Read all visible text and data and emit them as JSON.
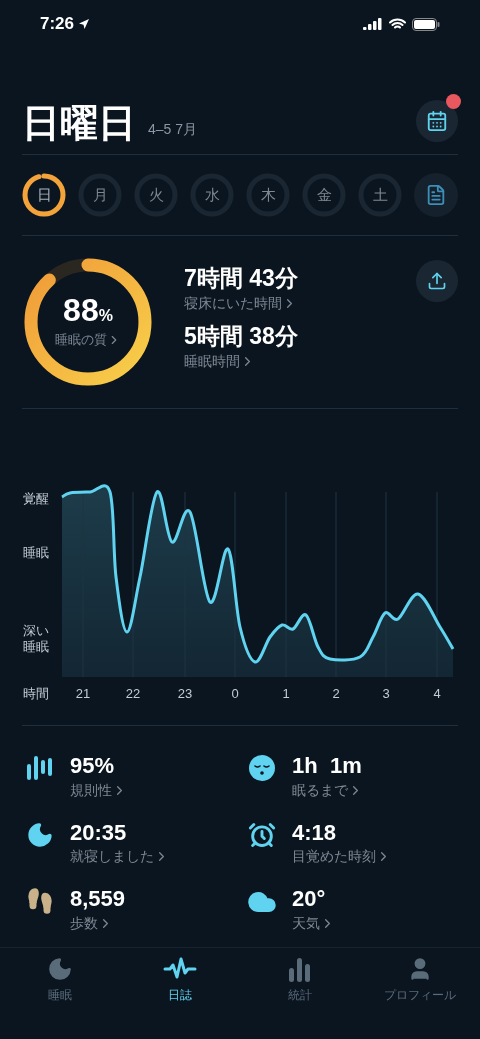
{
  "status_bar": {
    "time": "7:26"
  },
  "header": {
    "title": "日曜日",
    "date_range": "4–5 7月",
    "calendar_badge": true
  },
  "days": [
    {
      "label": "日",
      "selected": true
    },
    {
      "label": "月",
      "selected": false
    },
    {
      "label": "火",
      "selected": false
    },
    {
      "label": "水",
      "selected": false
    },
    {
      "label": "木",
      "selected": false
    },
    {
      "label": "金",
      "selected": false
    },
    {
      "label": "土",
      "selected": false
    }
  ],
  "summary": {
    "quality": {
      "value": "88",
      "unit": "%",
      "label": "睡眠の質",
      "level": 0.88
    },
    "metrics": [
      {
        "value": "7時間 43分",
        "label": "寝床にいた時間"
      },
      {
        "value": "5時間 38分",
        "label": "睡眠時間"
      }
    ]
  },
  "sleep_chart": {
    "y_labels": [
      {
        "lines": [
          "覚醒"
        ]
      },
      {
        "lines": [
          "睡眠"
        ]
      },
      {
        "lines": [
          "深い",
          "睡眠"
        ]
      }
    ],
    "x_title": "時間",
    "x_labels": [
      "21",
      "22",
      "23",
      "0",
      "1",
      "2",
      "3",
      "4"
    ]
  },
  "stats": [
    {
      "kind": "regularity",
      "value": "95%",
      "label": "規則性"
    },
    {
      "kind": "fall_asleep",
      "value": "1h  1m",
      "label": "眠るまで"
    },
    {
      "kind": "bedtime",
      "value": "20:35",
      "label": "就寝しました"
    },
    {
      "kind": "wake",
      "value": "4:18",
      "label": "目覚めた時刻"
    },
    {
      "kind": "steps",
      "value": "8,559",
      "label": "歩数"
    },
    {
      "kind": "weather",
      "value": "20°",
      "label": "天気"
    }
  ],
  "tab_bar": [
    {
      "kind": "sleep",
      "label": "睡眠",
      "selected": false
    },
    {
      "kind": "journal",
      "label": "日誌",
      "selected": true
    },
    {
      "kind": "stats",
      "label": "統計",
      "selected": false
    },
    {
      "kind": "profile",
      "label": "プロフィール",
      "selected": false
    }
  ]
}
